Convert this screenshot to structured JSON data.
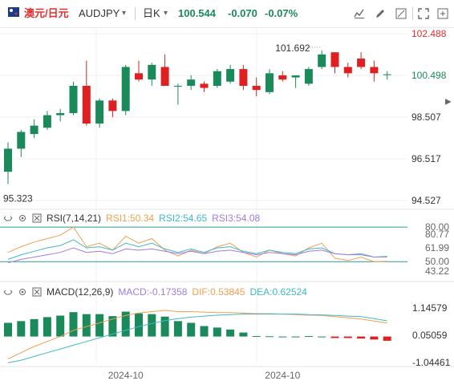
{
  "toolbar": {
    "symbol_cn": "澳元/日元",
    "symbol": "AUDJPY",
    "period": "日K",
    "price": "100.544",
    "change": "-0.070",
    "change_pct": "-0.07%"
  },
  "price_axis": {
    "labels": [
      "102.488",
      "100.498",
      "98.507",
      "96.517",
      "94.527"
    ],
    "high_label": "101.692",
    "low_label": "95.323",
    "last_label": "100.498"
  },
  "rsi": {
    "title": "RSI(7,14,21)",
    "rsi1": "RSI1:50.34",
    "rsi2": "RSI2:54.65",
    "rsi3": "RSI3:54.08",
    "axis": [
      "80.00",
      "80.77",
      "61.99",
      "50.00",
      "43.22"
    ]
  },
  "macd": {
    "title": "MACD(12,26,9)",
    "macd": "MACD:-0.17358",
    "dif": "DIF:0.53845",
    "dea": "DEA:0.62524",
    "axis": [
      "1.14579",
      "0.05059",
      "-1.04461"
    ]
  },
  "time_axis": [
    "2024-10",
    "2024-10"
  ],
  "colors": {
    "up": "#1a8a5b",
    "down": "#e02020",
    "accent": "#2a9d8f",
    "rsi1": "#f0a050",
    "rsi2": "#40b8c8",
    "rsi3": "#a07de0",
    "dif": "#f0a050",
    "dea": "#40b8c8"
  },
  "chart_data": {
    "type": "candlestick",
    "candles": [
      {
        "o": 95.9,
        "h": 97.3,
        "l": 95.32,
        "c": 97.0
      },
      {
        "o": 97.0,
        "h": 97.9,
        "l": 96.6,
        "c": 97.8
      },
      {
        "o": 97.7,
        "h": 98.4,
        "l": 97.5,
        "c": 98.1
      },
      {
        "o": 98.0,
        "h": 98.8,
        "l": 97.9,
        "c": 98.6
      },
      {
        "o": 98.6,
        "h": 98.9,
        "l": 98.3,
        "c": 98.7
      },
      {
        "o": 98.7,
        "h": 100.2,
        "l": 98.6,
        "c": 100.0
      },
      {
        "o": 100.0,
        "h": 101.2,
        "l": 98.1,
        "c": 98.2
      },
      {
        "o": 98.2,
        "h": 99.4,
        "l": 98.0,
        "c": 99.3
      },
      {
        "o": 99.3,
        "h": 99.4,
        "l": 98.5,
        "c": 98.8
      },
      {
        "o": 98.8,
        "h": 101.0,
        "l": 98.6,
        "c": 100.9
      },
      {
        "o": 100.6,
        "h": 101.2,
        "l": 100.2,
        "c": 100.3
      },
      {
        "o": 100.3,
        "h": 101.1,
        "l": 100.0,
        "c": 101.0
      },
      {
        "o": 100.9,
        "h": 101.5,
        "l": 100.0,
        "c": 100.0
      },
      {
        "o": 100.0,
        "h": 100.1,
        "l": 99.1,
        "c": 100.0
      },
      {
        "o": 100.0,
        "h": 100.5,
        "l": 99.8,
        "c": 100.3
      },
      {
        "o": 100.1,
        "h": 100.2,
        "l": 99.7,
        "c": 99.9
      },
      {
        "o": 100.0,
        "h": 100.8,
        "l": 99.9,
        "c": 100.7
      },
      {
        "o": 100.2,
        "h": 101.0,
        "l": 100.1,
        "c": 100.8
      },
      {
        "o": 100.8,
        "h": 101.0,
        "l": 99.8,
        "c": 100.0
      },
      {
        "o": 100.0,
        "h": 100.4,
        "l": 99.5,
        "c": 99.8
      },
      {
        "o": 99.7,
        "h": 100.8,
        "l": 99.6,
        "c": 100.6
      },
      {
        "o": 100.5,
        "h": 100.7,
        "l": 100.2,
        "c": 100.3
      },
      {
        "o": 100.4,
        "h": 100.5,
        "l": 99.9,
        "c": 100.5
      },
      {
        "o": 100.1,
        "h": 100.9,
        "l": 100.0,
        "c": 100.8
      },
      {
        "o": 100.9,
        "h": 101.69,
        "l": 100.8,
        "c": 101.5
      },
      {
        "o": 101.6,
        "h": 101.6,
        "l": 100.6,
        "c": 100.9
      },
      {
        "o": 100.9,
        "h": 101.1,
        "l": 100.4,
        "c": 100.6
      },
      {
        "o": 101.3,
        "h": 101.6,
        "l": 100.8,
        "c": 100.9
      },
      {
        "o": 100.9,
        "h": 101.2,
        "l": 100.2,
        "c": 100.6
      },
      {
        "o": 100.54,
        "h": 100.7,
        "l": 100.3,
        "c": 100.55
      }
    ],
    "rsi1": [
      58,
      63,
      67,
      70,
      73,
      80,
      63,
      66,
      60,
      72,
      66,
      70,
      60,
      55,
      60,
      57,
      63,
      66,
      58,
      54,
      60,
      57,
      55,
      62,
      66,
      53,
      51,
      54,
      50,
      50.34
    ],
    "rsi2": [
      52,
      56,
      59,
      62,
      64,
      69,
      62,
      63,
      60,
      66,
      63,
      66,
      61,
      58,
      61,
      58,
      62,
      63,
      59,
      57,
      60,
      58,
      57,
      61,
      62,
      57,
      56,
      57,
      54,
      54.65
    ],
    "rsi3": [
      49,
      52,
      54,
      56,
      58,
      62,
      58,
      59,
      57,
      61,
      60,
      61,
      59,
      57,
      59,
      57,
      59,
      60,
      58,
      56,
      58,
      57,
      56,
      59,
      60,
      57,
      56,
      56,
      54,
      54.08
    ],
    "macd_hist": [
      0.55,
      0.62,
      0.7,
      0.78,
      0.84,
      0.98,
      0.9,
      0.9,
      0.82,
      1.0,
      0.93,
      0.9,
      0.8,
      0.62,
      0.55,
      0.42,
      0.36,
      0.28,
      0.16,
      0.02,
      0.01,
      0.0,
      0.0,
      0.02,
      0.0,
      -0.06,
      -0.06,
      -0.08,
      -0.12,
      -0.17
    ],
    "dif": [
      -0.9,
      -0.65,
      -0.4,
      -0.2,
      0.0,
      0.25,
      0.4,
      0.55,
      0.7,
      0.85,
      0.95,
      1.0,
      1.05,
      1.0,
      1.0,
      0.98,
      0.96,
      0.96,
      0.94,
      0.92,
      0.92,
      0.9,
      0.88,
      0.86,
      0.85,
      0.8,
      0.75,
      0.7,
      0.62,
      0.54
    ],
    "dea": [
      -1.05,
      -0.95,
      -0.8,
      -0.65,
      -0.5,
      -0.35,
      -0.2,
      -0.05,
      0.1,
      0.25,
      0.4,
      0.52,
      0.64,
      0.72,
      0.78,
      0.82,
      0.86,
      0.88,
      0.9,
      0.9,
      0.9,
      0.9,
      0.9,
      0.88,
      0.87,
      0.85,
      0.82,
      0.8,
      0.72,
      0.63
    ],
    "price_range": [
      94.527,
      102.488
    ],
    "rsi_range": [
      43.22,
      80.77
    ],
    "macd_range": [
      -1.04461,
      1.14579
    ]
  }
}
